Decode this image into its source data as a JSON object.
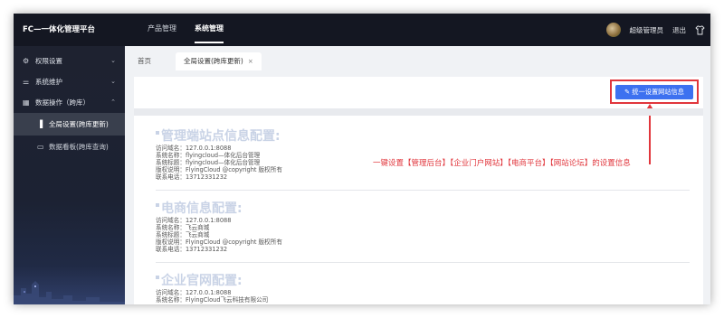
{
  "app": {
    "brand": "FC—一体化管理平台"
  },
  "topnav": [
    {
      "label": "产品管理",
      "active": false
    },
    {
      "label": "系统管理",
      "active": true
    }
  ],
  "user": {
    "name": "超级管理员",
    "logout": "退出"
  },
  "sidebar": {
    "items": [
      {
        "icon": "gear-icon",
        "label": "权限设置",
        "chevron": "⌄"
      },
      {
        "icon": "sliders-icon",
        "label": "系统维护",
        "chevron": "⌄"
      },
      {
        "icon": "grid-icon",
        "label": "数据操作（跨库）",
        "chevron": "⌃"
      }
    ],
    "subitems": [
      {
        "icon": "bar-chart-icon",
        "label": "全局设置(跨库更新)",
        "active": true
      },
      {
        "icon": "monitor-icon",
        "label": "数据看板(跨库查询)",
        "active": false
      }
    ]
  },
  "tabs": {
    "home": "首页",
    "current": "全局设置(跨库更新)",
    "close": "×"
  },
  "action_button": {
    "label": "统一设置网站信息"
  },
  "annotation": "一键设置【管理后台】【企业门户网站】【电商平台】【网站论坛】的设置信息",
  "sections": [
    {
      "title": "管理端站点信息配置:",
      "lines": [
        "访问域名：127.0.0.1:8088",
        "系统名称：flyingcloud—体化后台管理",
        "系统标题：flyingcloud—体化后台管理",
        "版权说明：FlyingCloud @copyright 版权所有",
        "联系电话：13712331232"
      ]
    },
    {
      "title": "电商信息配置:",
      "lines": [
        "访问域名：127.0.0.1:8088",
        "系统名称：飞云商城",
        "系统标题：飞云商城",
        "版权说明：FlyingCloud @copyright 版权所有",
        "联系电话：13712331232"
      ]
    },
    {
      "title": "企业官网配置:",
      "lines": [
        "访问域名：127.0.0.1:8088",
        "系统名称：FlyingCloud飞云科技有限公司"
      ]
    }
  ],
  "colors": {
    "topbar": "#141722",
    "accent": "#3d71f0",
    "annotation": "#e1363c"
  }
}
